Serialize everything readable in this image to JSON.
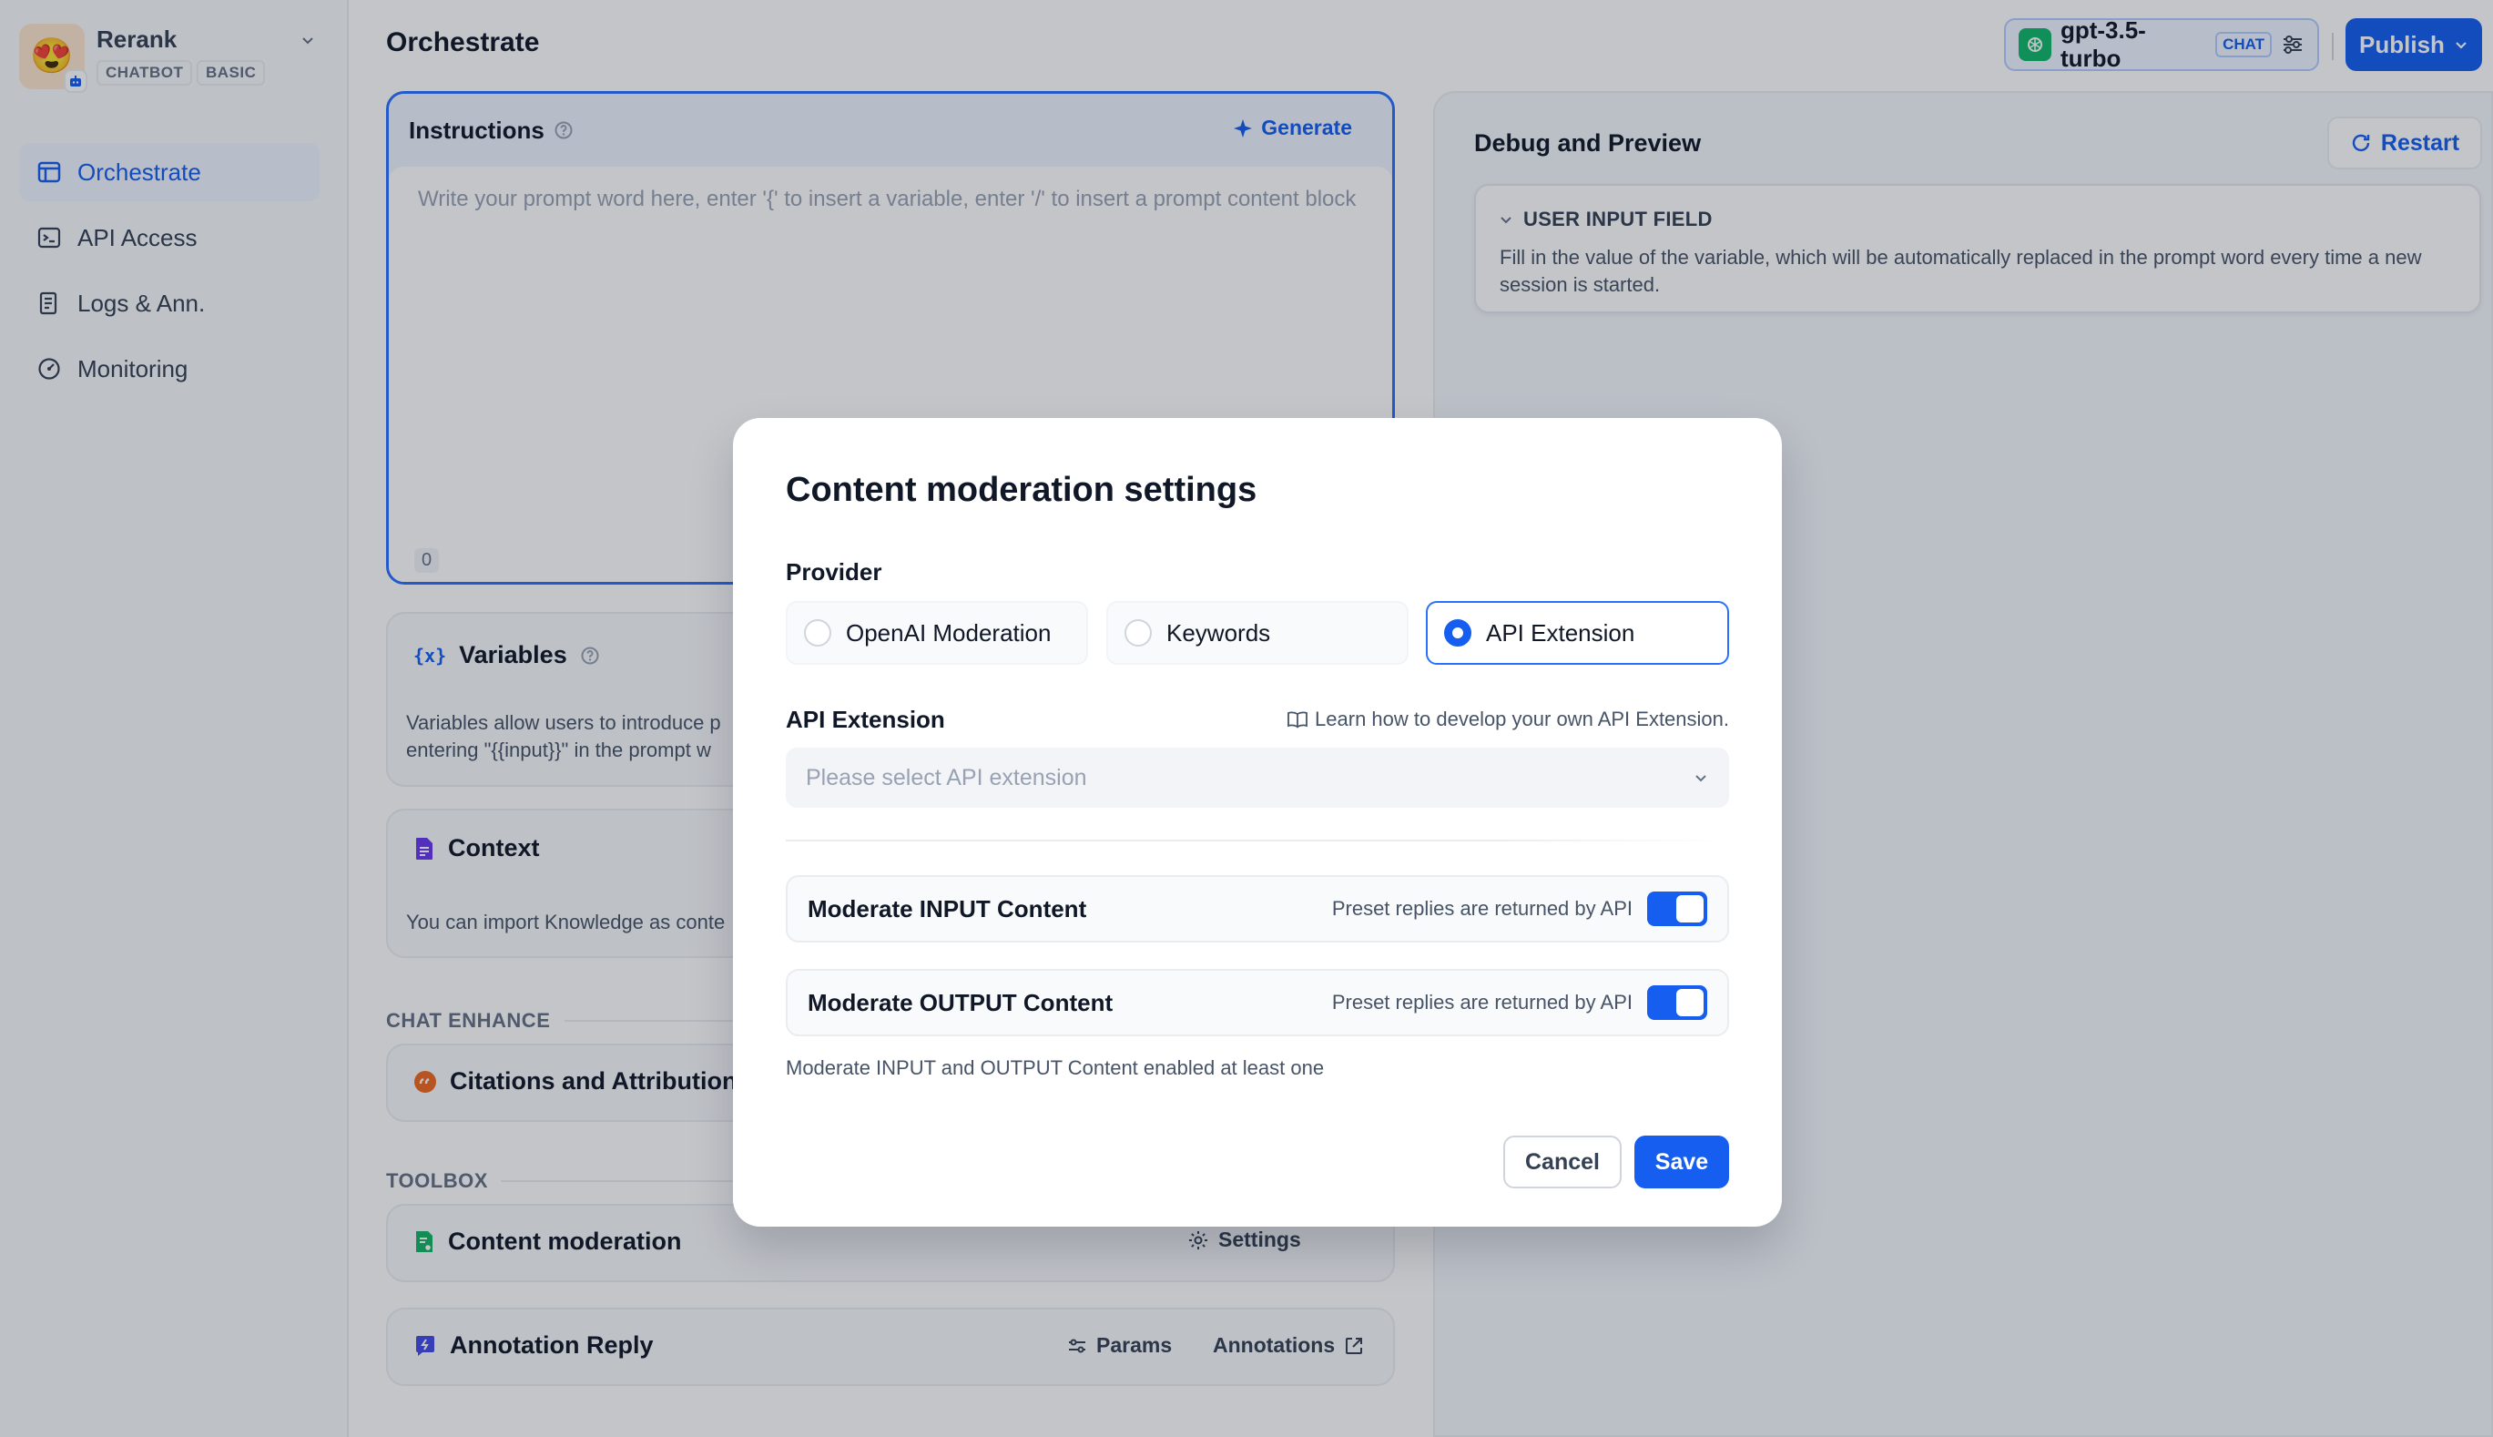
{
  "app": {
    "name": "Rerank",
    "emoji": "😍",
    "tags": [
      "CHATBOT",
      "BASIC"
    ]
  },
  "sidebar": {
    "items": [
      {
        "label": "Orchestrate",
        "icon": "layout-icon",
        "active": true
      },
      {
        "label": "API Access",
        "icon": "terminal-icon",
        "active": false
      },
      {
        "label": "Logs & Ann.",
        "icon": "file-list-icon",
        "active": false
      },
      {
        "label": "Monitoring",
        "icon": "gauge-icon",
        "active": false
      }
    ]
  },
  "header": {
    "title": "Orchestrate",
    "model_name": "gpt-3.5-turbo",
    "model_tag": "CHAT",
    "publish_label": "Publish"
  },
  "instructions": {
    "title": "Instructions",
    "generate_label": "Generate",
    "placeholder": "Write your prompt word here, enter '{' to insert a variable, enter '/' to insert a prompt content block",
    "char_count": "0"
  },
  "variables": {
    "title": "Variables",
    "desc_line1": "Variables allow users to introduce p",
    "desc_line2": "entering \"{{input}}\" in the prompt w"
  },
  "context": {
    "title": "Context",
    "desc": "You can import Knowledge as conte"
  },
  "chat_enhance": {
    "label": "CHAT ENHANCE",
    "citations_title": "Citations and Attributions"
  },
  "toolbox": {
    "label": "TOOLBOX",
    "content_moderation_title": "Content moderation",
    "settings_label": "Settings",
    "annotation_title": "Annotation Reply",
    "params_label": "Params",
    "annotations_label": "Annotations"
  },
  "debug": {
    "title": "Debug and Preview",
    "restart_label": "Restart",
    "user_input_title": "USER INPUT FIELD",
    "user_input_desc": "Fill in the value of the variable, which will be automatically replaced in the prompt word every time a new session is started."
  },
  "modal": {
    "title": "Content moderation settings",
    "provider_label": "Provider",
    "providers": [
      {
        "label": "OpenAI Moderation",
        "selected": false
      },
      {
        "label": "Keywords",
        "selected": false
      },
      {
        "label": "API Extension",
        "selected": true
      }
    ],
    "api_extension_label": "API Extension",
    "learn_link": "Learn how to develop your own API Extension.",
    "select_placeholder": "Please select API extension",
    "moderate_input_title": "Moderate INPUT Content",
    "moderate_input_hint": "Preset replies are returned by API",
    "moderate_input_enabled": true,
    "moderate_output_title": "Moderate OUTPUT Content",
    "moderate_output_hint": "Preset replies are returned by API",
    "moderate_output_enabled": true,
    "note": "Moderate INPUT and OUTPUT Content enabled at least one",
    "cancel_label": "Cancel",
    "save_label": "Save"
  },
  "colors": {
    "accent": "#155eef",
    "overlay": "rgba(16,24,40,0.25)"
  }
}
